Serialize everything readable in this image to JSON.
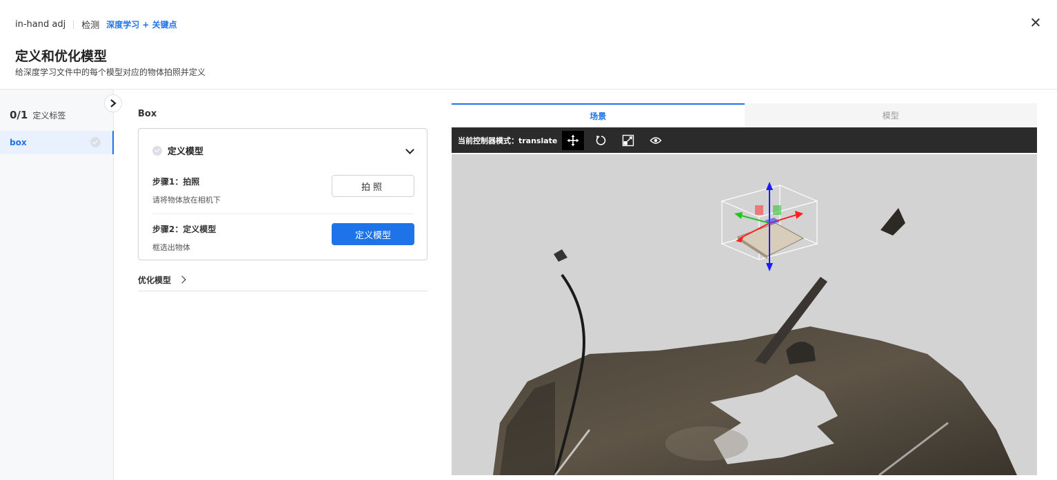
{
  "header": {
    "app_name": "in-hand adj",
    "step_name": "检测",
    "method_badge": "深度学习 + 关键点",
    "title": "定义和优化模型",
    "subtitle": "给深度学习文件中的每个模型对应的物体拍照并定义"
  },
  "sidebar": {
    "count": "0/1",
    "count_label": "定义标签",
    "items": [
      {
        "label": "box"
      }
    ]
  },
  "panel": {
    "object_title": "Box",
    "card": {
      "title": "定义模型",
      "steps": [
        {
          "title": "步骤1：拍照",
          "desc": "请将物体放在相机下",
          "button": "拍照"
        },
        {
          "title": "步骤2：定义模型",
          "desc": "框选出物体",
          "button": "定义模型"
        }
      ]
    },
    "optimize_label": "优化模型"
  },
  "viewer": {
    "tabs": [
      {
        "label": "场景"
      },
      {
        "label": "模型"
      }
    ],
    "active_tab": "场景",
    "toolbar_mode": "当前控制器模式：translate",
    "tools": [
      "translate-icon",
      "rotate-icon",
      "scale-icon",
      "visibility-icon"
    ]
  },
  "colors": {
    "accent": "#1e73e8",
    "toolbar_bg": "#2b2b2b",
    "viewport_bg": "#d3d3d3"
  }
}
